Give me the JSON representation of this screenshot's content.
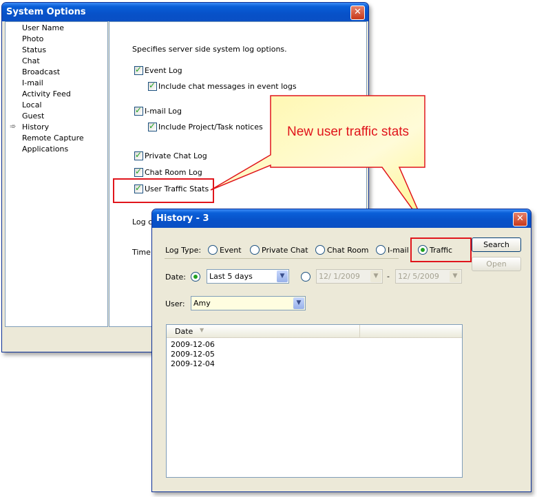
{
  "system_options": {
    "title": "System Options",
    "close_glyph": "✕",
    "nav_items": [
      "User Name",
      "Photo",
      "Status",
      "Chat",
      "Broadcast",
      "I-mail",
      "Activity Feed",
      "Local",
      "Guest",
      "History",
      "Remote Capture",
      "Applications"
    ],
    "selected_index": 9,
    "description": "Specifies server side system log options.",
    "options": {
      "event_log": "Event Log",
      "include_chat": "Include chat messages in event logs",
      "imail_log": "I-mail Log",
      "include_project": "Include Project/Task notices",
      "private_chat_log": "Private Chat Log",
      "chat_room_log": "Chat Room Log",
      "user_traffic_stats": "User Traffic Stats"
    },
    "log_partial": "Log cl",
    "time_partial": "Time z"
  },
  "callout": {
    "text": "New user traffic stats",
    "fill_color": "#fffaa0",
    "border_color": "#e0141b"
  },
  "history": {
    "title": "History - 3",
    "close_glyph": "✕",
    "log_type_label": "Log Type:",
    "log_types": [
      "Event",
      "Private Chat",
      "Chat Room",
      "I-mail",
      "Traffic"
    ],
    "selected_log_type": "Traffic",
    "search_button": "Search",
    "open_button": "Open",
    "date_label": "Date:",
    "date_preset": "Last 5 days",
    "date_from": "12/  1/2009",
    "date_to": "12/  5/2009",
    "date_separator": "-",
    "user_label": "User:",
    "user_value": "Amy",
    "list_header": "Date",
    "sort_glyph": "▼",
    "dates": [
      "2009-12-06",
      "2009-12-05",
      "2009-12-04"
    ]
  }
}
